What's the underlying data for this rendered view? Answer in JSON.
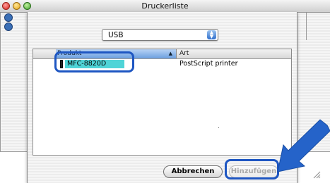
{
  "window": {
    "title": "Druckerliste"
  },
  "sheet": {
    "connection_popup": {
      "value": "USB",
      "options_visible": [
        "USB"
      ]
    },
    "table": {
      "columns": [
        "Produkt",
        "Art"
      ],
      "sort_column": "Produkt",
      "rows": [
        {
          "product": "MFC-8820D",
          "type": "PostScript printer",
          "selected": true
        }
      ]
    },
    "buttons": {
      "cancel": "Abbrechen",
      "add": "Hinzufügen"
    }
  },
  "colors": {
    "highlight_outline": "#1e56c2",
    "selection": "#4fd4d7",
    "callout_arrow": "#2563c9"
  },
  "icons": [
    "close-icon",
    "minimize-icon",
    "zoom-icon",
    "popup-arrows-icon",
    "sort-ascending-icon",
    "printer-icon",
    "resize-grip-icon",
    "callout-arrow-icon"
  ]
}
